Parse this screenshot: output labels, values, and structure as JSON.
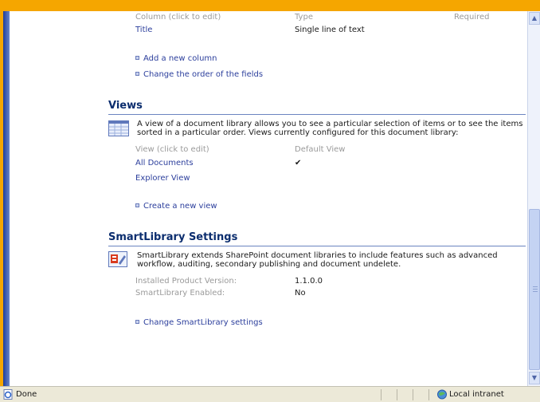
{
  "columns": {
    "header_column": "Column (click to edit)",
    "header_type": "Type",
    "header_required": "Required",
    "rows": [
      {
        "name": "Title",
        "type": "Single line of text"
      }
    ],
    "links": {
      "add_column": "Add a new column",
      "change_order": "Change the order of the fields"
    }
  },
  "views": {
    "title": "Views",
    "description": "A view of a document library allows you to see a particular selection of items or to see the items sorted in a particular order. Views currently configured for this document library:",
    "header_view": "View (click to edit)",
    "header_default": "Default View",
    "rows": [
      {
        "name": "All Documents",
        "default_mark": "✔"
      },
      {
        "name": "Explorer View",
        "default_mark": ""
      }
    ],
    "create_link": "Create a new view"
  },
  "smartlibrary": {
    "title": "SmartLibrary Settings",
    "description": "SmartLibrary extends SharePoint document libraries to include features such as advanced workflow, auditing, secondary publishing and document undelete.",
    "version_label": "Installed Product Version:",
    "version_value": "1.1.0.0",
    "enabled_label": "SmartLibrary Enabled:",
    "enabled_value": "No",
    "change_link": "Change SmartLibrary settings"
  },
  "statusbar": {
    "status": "Done",
    "zone": "Local intranet"
  },
  "icons": {
    "views_icon": "view-list-icon",
    "smartlibrary_icon": "settings-gear-icon",
    "page_icon": "ie-page-icon",
    "zone_icon": "intranet-globe-icon"
  },
  "colors": {
    "section_title": "#0b2d6e",
    "link": "#2b3e9c",
    "rule": "#6b84c0",
    "frame_accent": "#f5a600"
  }
}
